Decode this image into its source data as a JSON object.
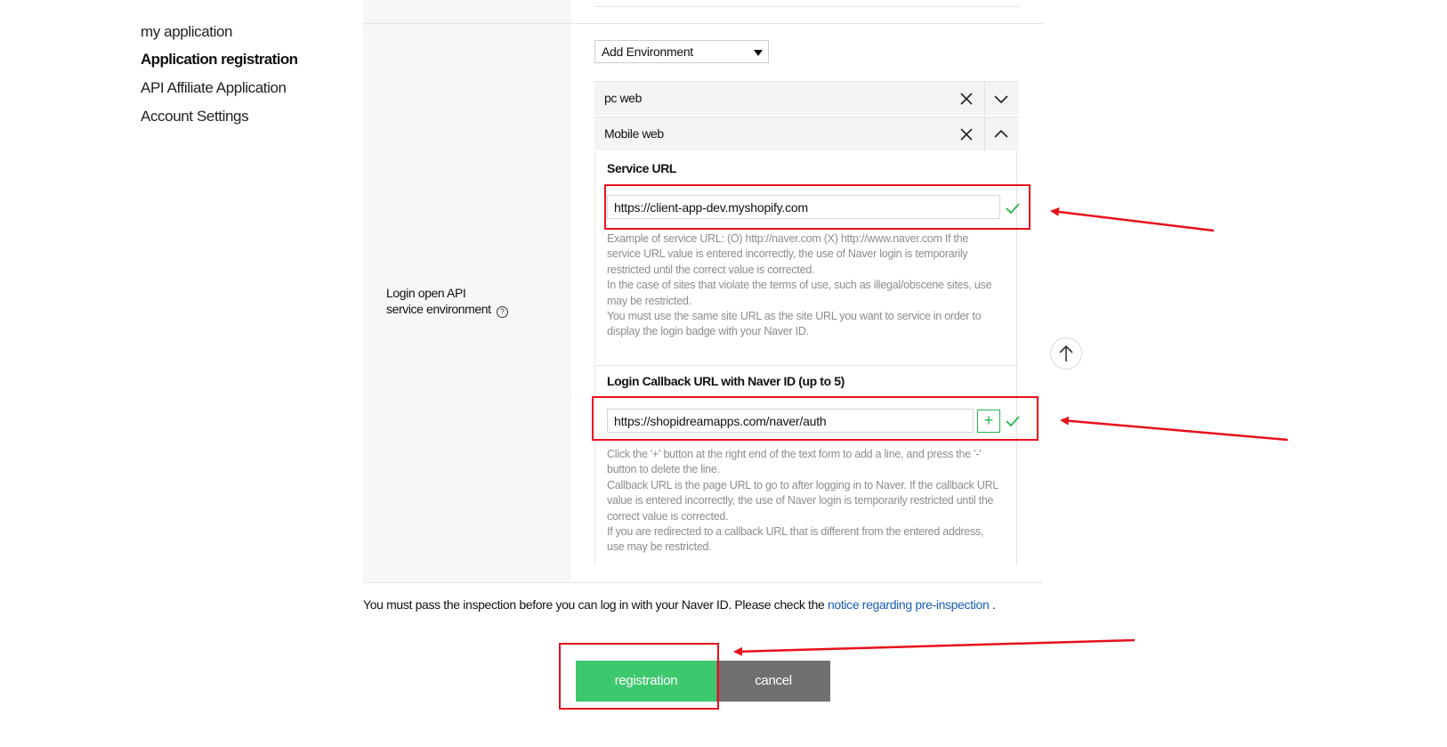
{
  "sidebar": {
    "items": [
      {
        "label": "my application",
        "active": false
      },
      {
        "label": "Application registration",
        "active": true
      },
      {
        "label": "API Affiliate Application",
        "active": false
      },
      {
        "label": "Account Settings",
        "active": false
      }
    ]
  },
  "form": {
    "row_label_line1": "Login open API",
    "row_label_line2": "service environment",
    "help_icon_glyph": "?",
    "add_environment": {
      "selected": "Add Environment"
    },
    "environments": [
      {
        "name": "pc web",
        "expanded": false
      },
      {
        "name": "Mobile web",
        "expanded": true
      }
    ],
    "service_url": {
      "title": "Service URL",
      "value": "https://client-app-dev.myshopify.com",
      "help": [
        "Example of service URL: (O) http://naver.com (X) http://www.naver.com If the service URL value is entered incorrectly, the use of Naver login is temporarily restricted until the correct value is corrected.",
        "In the case of sites that violate the terms of use, such as illegal/obscene sites, use may be restricted.",
        "You must use the same site URL as the site URL you want to service in order to display the login badge with your Naver ID."
      ]
    },
    "callback_url": {
      "title": "Login Callback URL with Naver ID (up to 5)",
      "value": "https://shopidreamapps.com/naver/auth",
      "add_glyph": "+",
      "help": [
        "Click the '+' button at the right end of the text form to add a line, and press the '-' button to delete the line.",
        "Callback URL is the page URL to go to after logging in to Naver. If the callback URL value is entered incorrectly, the use of Naver login is temporarily restricted until the correct value is corrected.",
        "If you are redirected to a callback URL that is different from the entered address, use may be restricted."
      ]
    }
  },
  "notice": {
    "text": "You must pass the inspection before you can log in with your Naver ID. Please check the ",
    "link": "notice regarding pre-inspection",
    "suffix": " ."
  },
  "buttons": {
    "register": "registration",
    "cancel": "cancel"
  },
  "colors": {
    "accent_green": "#3ec86e",
    "check_green": "#27b64f",
    "link_blue": "#1a5db8",
    "annotation_red": "#e8101b",
    "cancel_gray": "#707070"
  }
}
